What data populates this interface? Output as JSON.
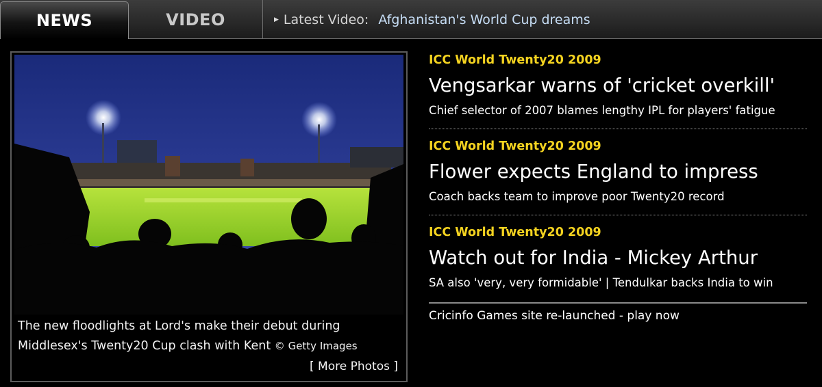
{
  "tabs": {
    "news": "NEWS",
    "video": "VIDEO"
  },
  "latest_video": {
    "label": "Latest Video:",
    "title": "Afghanistan's World Cup dreams"
  },
  "photo": {
    "caption": "The new floodlights at Lord's make their debut during Middlesex's Twenty20 Cup clash with Kent",
    "credit": "© Getty Images",
    "more_photos": "[ More Photos ]"
  },
  "stories": [
    {
      "category": "ICC World Twenty20 2009",
      "headline": "Vengsarkar warns of 'cricket overkill'",
      "summary": "Chief selector of 2007 blames lengthy IPL for players' fatigue"
    },
    {
      "category": "ICC World Twenty20 2009",
      "headline": "Flower expects England to impress",
      "summary": "Coach backs team to improve poor Twenty20 record"
    },
    {
      "category": "ICC World Twenty20 2009",
      "headline": "Watch out for India - Mickey Arthur",
      "summary": "SA also 'very, very formidable'",
      "summary_separator": "|",
      "summary_link": "Tendulkar backs India to win"
    }
  ],
  "games_link": "Cricinfo Games site re-launched - play now",
  "colors": {
    "category": "#f4d320",
    "link_blue": "#c6ddf5",
    "background": "#000000"
  }
}
